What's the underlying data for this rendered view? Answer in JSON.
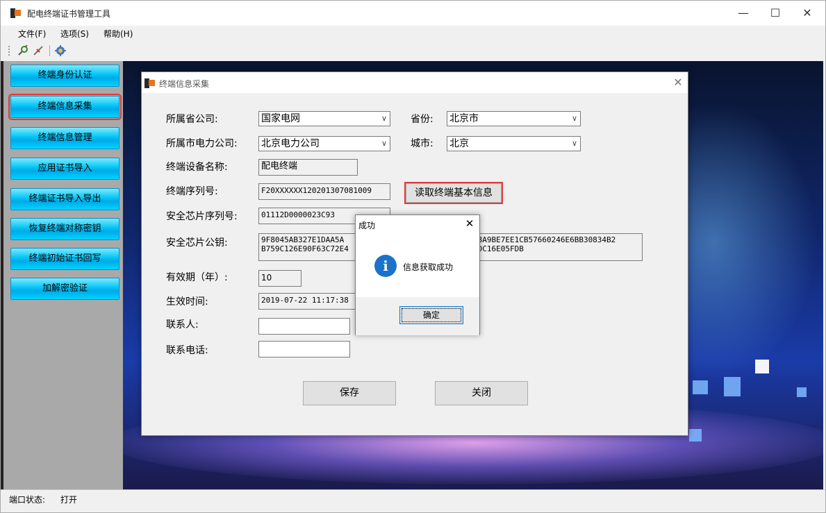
{
  "app": {
    "title": "配电终端证书管理工具",
    "window_controls": {
      "minimize": "—",
      "maximize": "☐",
      "close": "✕"
    }
  },
  "menu": {
    "file": "文件(F)",
    "options": "选项(S)",
    "help": "帮助(H)"
  },
  "toolbar": {
    "icons": [
      "connect-icon",
      "disconnect-icon",
      "settings-icon"
    ]
  },
  "sidebar": {
    "items": [
      {
        "label": "终端身份认证"
      },
      {
        "label": "终端信息采集",
        "selected": true
      },
      {
        "label": "终端信息管理"
      },
      {
        "label": "应用证书导入"
      },
      {
        "label": "终端证书导入导出"
      },
      {
        "label": "恢复终端对称密钥"
      },
      {
        "label": "终端初始证书回写"
      },
      {
        "label": "加解密验证"
      }
    ]
  },
  "dialog": {
    "title": "终端信息采集",
    "close": "✕",
    "fields": {
      "province_company_label": "所属省公司:",
      "province_company_value": "国家电网",
      "province_label": "省份:",
      "province_value": "北京市",
      "city_company_label": "所属市电力公司:",
      "city_company_value": "北京电力公司",
      "city_label": "城市:",
      "city_value": "北京",
      "device_name_label": "终端设备名称:",
      "device_name_value": "配电终端",
      "serial_label": "终端序列号:",
      "serial_value": "F20XXXXXX120201307081009",
      "read_button": "读取终端基本信息",
      "chip_serial_label": "安全芯片序列号:",
      "chip_serial_value": "01112D0000023C93",
      "chip_key_label": "安全芯片公钥:",
      "chip_key_line1_left": "9F8045AB327E1DAA5A",
      "chip_key_line1_right": "08A9BE7EE1CB57660246E6BB30834B2",
      "chip_key_line2_left": "B759C126E90F63C72E4",
      "chip_key_line2_right": "4DC16E05FDB",
      "validity_label": "有效期（年）:",
      "validity_value": "10",
      "effective_time_label": "生效时间:",
      "effective_time_value": "2019-07-22 11:17:38",
      "contact_label": "联系人:",
      "contact_value": "",
      "phone_label": "联系电话:",
      "phone_value": ""
    },
    "buttons": {
      "save": "保存",
      "close": "关闭"
    }
  },
  "message_box": {
    "title": "成功",
    "close": "✕",
    "icon": "info-icon",
    "icon_glyph": "i",
    "text": "信息获取成功",
    "ok": "确定"
  },
  "status": {
    "label": "端口状态:",
    "value": "打开"
  },
  "colors": {
    "nav_button": "#00c4f5",
    "highlight_red": "#e03a3a",
    "info_blue": "#1a73c8"
  }
}
